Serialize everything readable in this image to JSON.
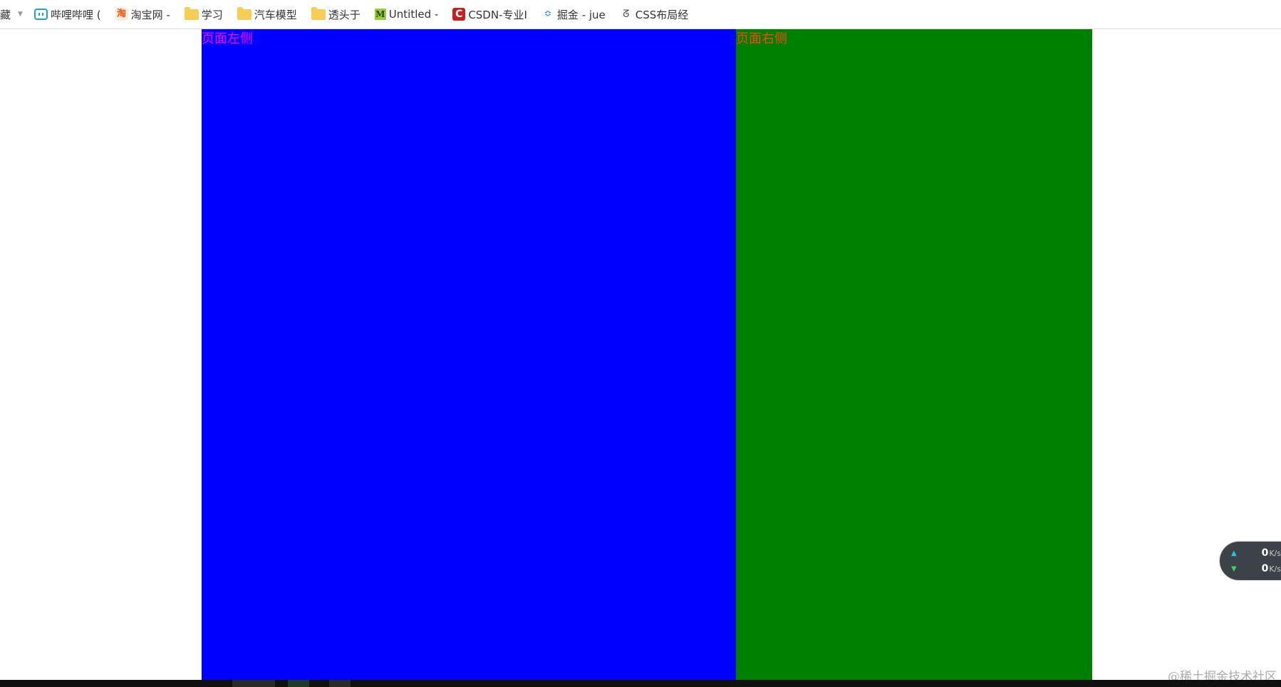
{
  "bookmarks_bar": {
    "favorites_label": "收藏",
    "items": [
      {
        "label": "哔哩哔哩 (",
        "icon": "bilibili-icon"
      },
      {
        "label": "淘宝网 -",
        "icon": "taobao-icon"
      },
      {
        "label": "学习",
        "icon": "folder-icon"
      },
      {
        "label": "汽车模型",
        "icon": "folder-icon"
      },
      {
        "label": "透头于",
        "icon": "folder-icon"
      },
      {
        "label": "Untitled -",
        "icon": "mdn-icon"
      },
      {
        "label": "CSDN-专业I",
        "icon": "csdn-icon"
      },
      {
        "label": "掘金 - jue",
        "icon": "juejin-icon"
      },
      {
        "label": "CSS布局经",
        "icon": "css-site-icon"
      }
    ]
  },
  "page": {
    "left_panel": {
      "label": "页面左侧",
      "background": "#0000ff",
      "text_color": "#ff00ff"
    },
    "right_panel": {
      "label": "页面右侧",
      "background": "#008000",
      "text_color": "#ff4500"
    }
  },
  "net_widget": {
    "upload_value": "0",
    "download_value": "0",
    "unit": "K/s",
    "upload_arrow_color": "#2ec4e0",
    "download_arrow_color": "#3ecf6a"
  },
  "watermark": "@稀土掘金技术社区"
}
